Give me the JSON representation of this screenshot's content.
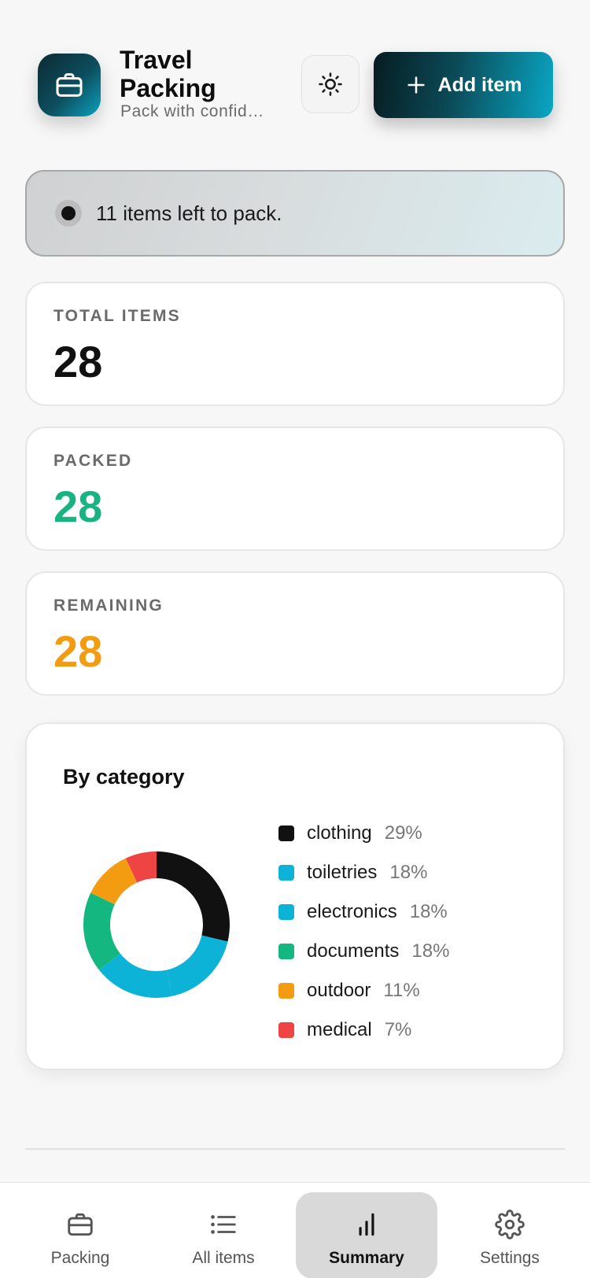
{
  "header": {
    "title": "Travel Packing",
    "subtitle": "Pack with confid…",
    "add_button_label": "Add item"
  },
  "banner": {
    "text": "11 items left to pack."
  },
  "stats": [
    {
      "label": "TOTAL ITEMS",
      "value": "28",
      "color": "#111111"
    },
    {
      "label": "PACKED",
      "value": "28",
      "color": "#19b381"
    },
    {
      "label": "REMAINING",
      "value": "28",
      "color": "#f39c12"
    }
  ],
  "chart_card": {
    "title": "By category"
  },
  "chart_data": {
    "type": "pie",
    "title": "By category",
    "categories": [
      "clothing",
      "toiletries",
      "electronics",
      "documents",
      "outdoor",
      "medical"
    ],
    "values": [
      29,
      18,
      18,
      18,
      11,
      7
    ],
    "labels": [
      "29%",
      "18%",
      "18%",
      "18%",
      "11%",
      "7%"
    ],
    "colors": [
      "#111111",
      "#0db3d6",
      "#0db3d6",
      "#14b77f",
      "#f39c12",
      "#ef4444"
    ],
    "legend": "right",
    "donut": true
  },
  "nav": {
    "items": [
      {
        "label": "Packing",
        "icon": "briefcase-icon",
        "active": false
      },
      {
        "label": "All items",
        "icon": "list-icon",
        "active": false
      },
      {
        "label": "Summary",
        "icon": "bar-chart-icon",
        "active": true
      },
      {
        "label": "Settings",
        "icon": "gear-icon",
        "active": false
      }
    ]
  }
}
